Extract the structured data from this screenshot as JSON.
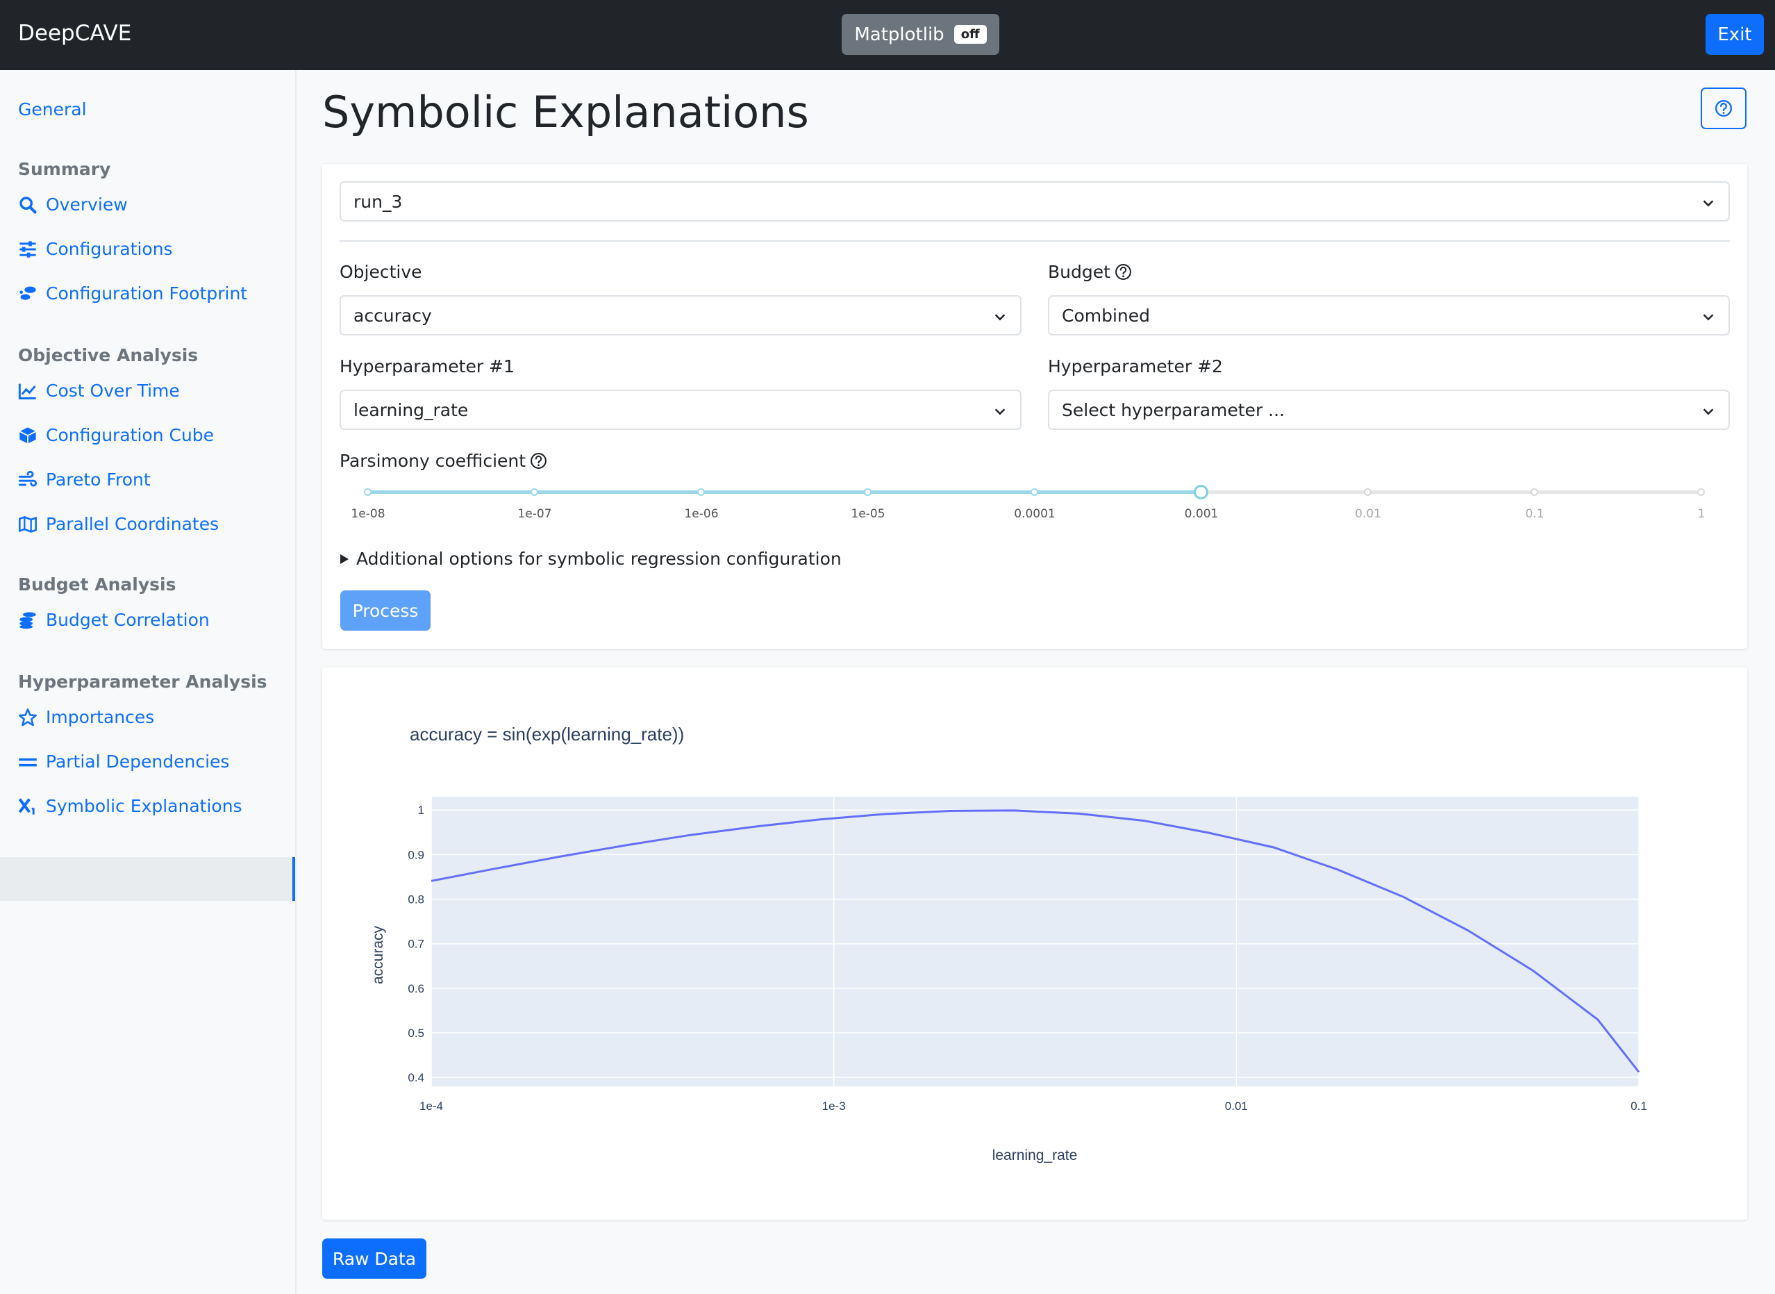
{
  "navbar": {
    "brand": "DeepCAVE",
    "matplotlib_label": "Matplotlib",
    "matplotlib_state": "off",
    "exit_label": "Exit"
  },
  "sidebar": {
    "general": "General",
    "sections": [
      {
        "title": "Summary",
        "items": [
          {
            "label": "Overview",
            "icon": "search-icon"
          },
          {
            "label": "Configurations",
            "icon": "sliders-icon"
          },
          {
            "label": "Configuration Footprint",
            "icon": "footprint-icon"
          }
        ]
      },
      {
        "title": "Objective Analysis",
        "items": [
          {
            "label": "Cost Over Time",
            "icon": "line-chart-icon"
          },
          {
            "label": "Configuration Cube",
            "icon": "cube-icon"
          },
          {
            "label": "Pareto Front",
            "icon": "wind-icon"
          },
          {
            "label": "Parallel Coordinates",
            "icon": "map-icon"
          }
        ]
      },
      {
        "title": "Budget Analysis",
        "items": [
          {
            "label": "Budget Correlation",
            "icon": "coins-icon"
          }
        ]
      },
      {
        "title": "Hyperparameter Analysis",
        "items": [
          {
            "label": "Importances",
            "icon": "star-icon"
          },
          {
            "label": "Partial Dependencies",
            "icon": "equals-icon"
          },
          {
            "label": "Symbolic Explanations",
            "icon": "subscript-x-icon",
            "active": true
          }
        ]
      }
    ]
  },
  "page": {
    "title": "Symbolic Explanations"
  },
  "form": {
    "run_select": "run_3",
    "objective_label": "Objective",
    "objective_value": "accuracy",
    "budget_label": "Budget",
    "budget_value": "Combined",
    "hp1_label": "Hyperparameter #1",
    "hp1_value": "learning_rate",
    "hp2_label": "Hyperparameter #2",
    "hp2_placeholder": "Select hyperparameter ...",
    "parsimony_label": "Parsimony coefficient",
    "parsimony_ticks": [
      "1e-08",
      "1e-07",
      "1e-06",
      "1e-05",
      "0.0001",
      "0.001",
      "0.01",
      "0.1",
      "1"
    ],
    "parsimony_selected": "0.001",
    "details_label": "Additional options for symbolic regression configuration",
    "process_label": "Process"
  },
  "raw_data_label": "Raw Data",
  "colors": {
    "accent": "#0d6efd",
    "line": "#636efa",
    "plot_bg": "#e5ecf6",
    "slider": "#9ad8e8"
  },
  "chart_data": {
    "type": "line",
    "title": "accuracy = sin(exp(learning_rate))",
    "xlabel": "learning_rate",
    "ylabel": "accuracy",
    "xscale": "log",
    "xlim": [
      0.0001,
      0.1
    ],
    "ylim": [
      0.38,
      1.03
    ],
    "x_ticks": [
      {
        "value": 0.0001,
        "label": "1e-4"
      },
      {
        "value": 0.001,
        "label": "1e-3"
      },
      {
        "value": 0.01,
        "label": "0.01"
      },
      {
        "value": 0.1,
        "label": "0.1"
      }
    ],
    "y_ticks": [
      0.4,
      0.5,
      0.6,
      0.7,
      0.8,
      0.9,
      1
    ],
    "grid": true,
    "series": [
      {
        "x": [
          0.0001,
          0.000145,
          0.00021,
          0.000305,
          0.00044,
          0.00064,
          0.000925,
          0.00134,
          0.00194,
          0.00281,
          0.00407,
          0.0059,
          0.00854,
          0.0124,
          0.0179,
          0.026,
          0.0376,
          0.0545,
          0.079,
          0.1
        ],
        "y": [
          0.841,
          0.869,
          0.896,
          0.921,
          0.944,
          0.963,
          0.979,
          0.991,
          0.998,
          0.999,
          0.992,
          0.976,
          0.949,
          0.916,
          0.866,
          0.805,
          0.73,
          0.64,
          0.53,
          0.412
        ]
      }
    ]
  }
}
